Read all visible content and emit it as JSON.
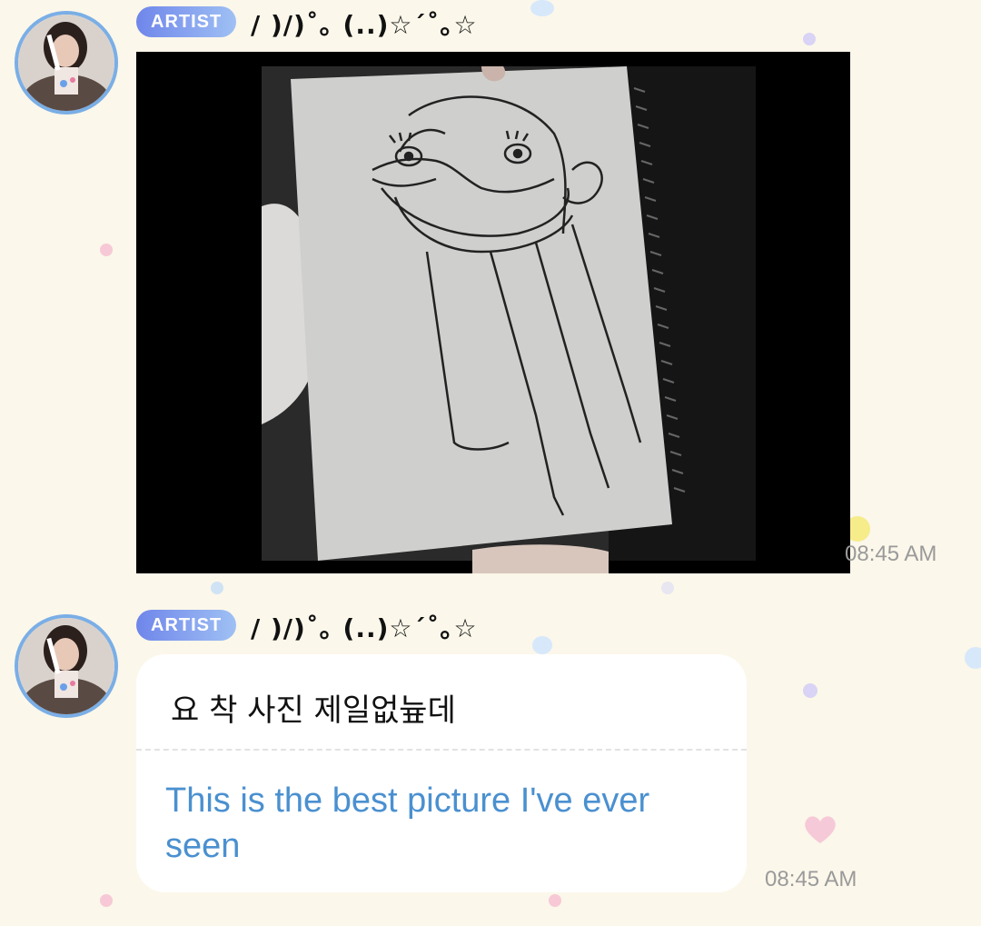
{
  "messages": [
    {
      "badge": "ARTIST",
      "nickname": "/ )/)˚｡ (..)☆´˚｡☆",
      "type": "image",
      "time": "08:45 AM"
    },
    {
      "badge": "ARTIST",
      "nickname": "/ )/)˚｡ (..)☆´˚｡☆",
      "type": "text",
      "original_text": "요 착 사진 제일없늎데",
      "translated_text": "This is the best picture I've ever seen",
      "time": "08:45 AM"
    }
  ],
  "colors": {
    "background": "#fbf7ea",
    "badge_gradient_start": "#6f86ea",
    "badge_gradient_end": "#9fc0f4",
    "translation_text": "#4a90d0",
    "avatar_ring": "#7aaee6"
  },
  "icons": [
    "profile-avatar",
    "sketch-photo",
    "heart-decoration"
  ]
}
